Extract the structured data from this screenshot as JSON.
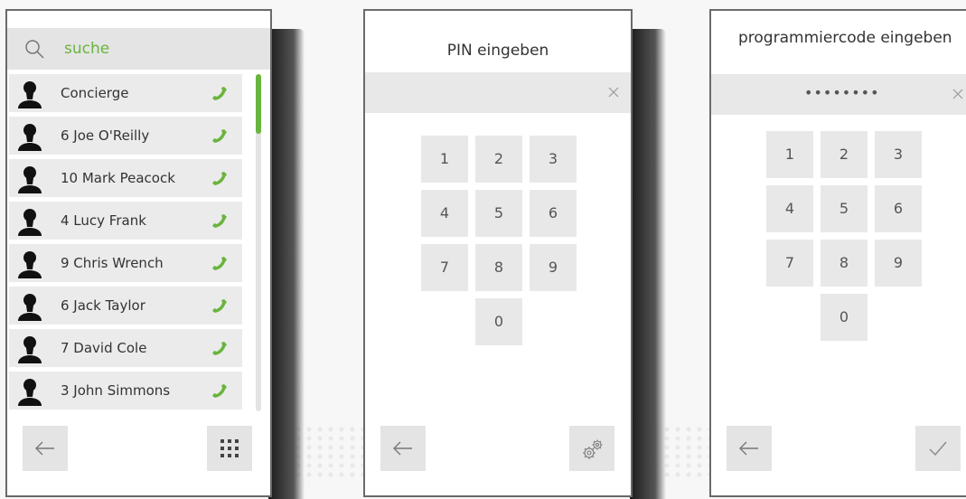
{
  "colors": {
    "accent": "#6ab43e",
    "button_bg": "#e4e4e4",
    "row_bg": "#ebebeb"
  },
  "contacts_screen": {
    "search": {
      "icon": "search-icon",
      "placeholder": "suche"
    },
    "contacts": [
      {
        "name": "Concierge"
      },
      {
        "name": "6 Joe O'Reilly"
      },
      {
        "name": "10 Mark Peacock"
      },
      {
        "name": "4 Lucy Frank"
      },
      {
        "name": "9 Chris Wrench"
      },
      {
        "name": "6 Jack Taylor"
      },
      {
        "name": "7 David Cole"
      },
      {
        "name": "3 John Simmons"
      }
    ],
    "back_icon": "arrow-left-icon",
    "keypad_icon": "keypad-grid-icon"
  },
  "pin_screen": {
    "title": "PIN eingeben",
    "entered_value": "",
    "keys": [
      "1",
      "2",
      "3",
      "4",
      "5",
      "6",
      "7",
      "8",
      "9",
      "0"
    ],
    "back_icon": "arrow-left-icon",
    "settings_icon": "gears-icon"
  },
  "code_screen": {
    "title": "programmiercode eingeben",
    "masked_value": "••••••••",
    "keys": [
      "1",
      "2",
      "3",
      "4",
      "5",
      "6",
      "7",
      "8",
      "9",
      "0"
    ],
    "back_icon": "arrow-left-icon",
    "confirm_icon": "checkmark-icon"
  }
}
